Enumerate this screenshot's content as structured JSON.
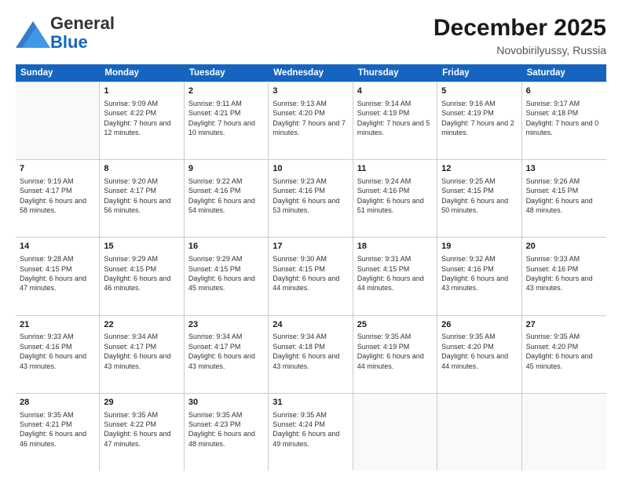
{
  "logo": {
    "line1": "General",
    "line2": "Blue"
  },
  "header": {
    "month": "December 2025",
    "location": "Novobirilyussy, Russia"
  },
  "days": [
    "Sunday",
    "Monday",
    "Tuesday",
    "Wednesday",
    "Thursday",
    "Friday",
    "Saturday"
  ],
  "weeks": [
    [
      {
        "num": "",
        "sunrise": "",
        "sunset": "",
        "daylight": ""
      },
      {
        "num": "1",
        "sunrise": "Sunrise: 9:09 AM",
        "sunset": "Sunset: 4:22 PM",
        "daylight": "Daylight: 7 hours and 12 minutes."
      },
      {
        "num": "2",
        "sunrise": "Sunrise: 9:11 AM",
        "sunset": "Sunset: 4:21 PM",
        "daylight": "Daylight: 7 hours and 10 minutes."
      },
      {
        "num": "3",
        "sunrise": "Sunrise: 9:13 AM",
        "sunset": "Sunset: 4:20 PM",
        "daylight": "Daylight: 7 hours and 7 minutes."
      },
      {
        "num": "4",
        "sunrise": "Sunrise: 9:14 AM",
        "sunset": "Sunset: 4:19 PM",
        "daylight": "Daylight: 7 hours and 5 minutes."
      },
      {
        "num": "5",
        "sunrise": "Sunrise: 9:16 AM",
        "sunset": "Sunset: 4:19 PM",
        "daylight": "Daylight: 7 hours and 2 minutes."
      },
      {
        "num": "6",
        "sunrise": "Sunrise: 9:17 AM",
        "sunset": "Sunset: 4:18 PM",
        "daylight": "Daylight: 7 hours and 0 minutes."
      }
    ],
    [
      {
        "num": "7",
        "sunrise": "Sunrise: 9:19 AM",
        "sunset": "Sunset: 4:17 PM",
        "daylight": "Daylight: 6 hours and 58 minutes."
      },
      {
        "num": "8",
        "sunrise": "Sunrise: 9:20 AM",
        "sunset": "Sunset: 4:17 PM",
        "daylight": "Daylight: 6 hours and 56 minutes."
      },
      {
        "num": "9",
        "sunrise": "Sunrise: 9:22 AM",
        "sunset": "Sunset: 4:16 PM",
        "daylight": "Daylight: 6 hours and 54 minutes."
      },
      {
        "num": "10",
        "sunrise": "Sunrise: 9:23 AM",
        "sunset": "Sunset: 4:16 PM",
        "daylight": "Daylight: 6 hours and 53 minutes."
      },
      {
        "num": "11",
        "sunrise": "Sunrise: 9:24 AM",
        "sunset": "Sunset: 4:16 PM",
        "daylight": "Daylight: 6 hours and 51 minutes."
      },
      {
        "num": "12",
        "sunrise": "Sunrise: 9:25 AM",
        "sunset": "Sunset: 4:15 PM",
        "daylight": "Daylight: 6 hours and 50 minutes."
      },
      {
        "num": "13",
        "sunrise": "Sunrise: 9:26 AM",
        "sunset": "Sunset: 4:15 PM",
        "daylight": "Daylight: 6 hours and 48 minutes."
      }
    ],
    [
      {
        "num": "14",
        "sunrise": "Sunrise: 9:28 AM",
        "sunset": "Sunset: 4:15 PM",
        "daylight": "Daylight: 6 hours and 47 minutes."
      },
      {
        "num": "15",
        "sunrise": "Sunrise: 9:29 AM",
        "sunset": "Sunset: 4:15 PM",
        "daylight": "Daylight: 6 hours and 46 minutes."
      },
      {
        "num": "16",
        "sunrise": "Sunrise: 9:29 AM",
        "sunset": "Sunset: 4:15 PM",
        "daylight": "Daylight: 6 hours and 45 minutes."
      },
      {
        "num": "17",
        "sunrise": "Sunrise: 9:30 AM",
        "sunset": "Sunset: 4:15 PM",
        "daylight": "Daylight: 6 hours and 44 minutes."
      },
      {
        "num": "18",
        "sunrise": "Sunrise: 9:31 AM",
        "sunset": "Sunset: 4:15 PM",
        "daylight": "Daylight: 6 hours and 44 minutes."
      },
      {
        "num": "19",
        "sunrise": "Sunrise: 9:32 AM",
        "sunset": "Sunset: 4:16 PM",
        "daylight": "Daylight: 6 hours and 43 minutes."
      },
      {
        "num": "20",
        "sunrise": "Sunrise: 9:33 AM",
        "sunset": "Sunset: 4:16 PM",
        "daylight": "Daylight: 6 hours and 43 minutes."
      }
    ],
    [
      {
        "num": "21",
        "sunrise": "Sunrise: 9:33 AM",
        "sunset": "Sunset: 4:16 PM",
        "daylight": "Daylight: 6 hours and 43 minutes."
      },
      {
        "num": "22",
        "sunrise": "Sunrise: 9:34 AM",
        "sunset": "Sunset: 4:17 PM",
        "daylight": "Daylight: 6 hours and 43 minutes."
      },
      {
        "num": "23",
        "sunrise": "Sunrise: 9:34 AM",
        "sunset": "Sunset: 4:17 PM",
        "daylight": "Daylight: 6 hours and 43 minutes."
      },
      {
        "num": "24",
        "sunrise": "Sunrise: 9:34 AM",
        "sunset": "Sunset: 4:18 PM",
        "daylight": "Daylight: 6 hours and 43 minutes."
      },
      {
        "num": "25",
        "sunrise": "Sunrise: 9:35 AM",
        "sunset": "Sunset: 4:19 PM",
        "daylight": "Daylight: 6 hours and 44 minutes."
      },
      {
        "num": "26",
        "sunrise": "Sunrise: 9:35 AM",
        "sunset": "Sunset: 4:20 PM",
        "daylight": "Daylight: 6 hours and 44 minutes."
      },
      {
        "num": "27",
        "sunrise": "Sunrise: 9:35 AM",
        "sunset": "Sunset: 4:20 PM",
        "daylight": "Daylight: 6 hours and 45 minutes."
      }
    ],
    [
      {
        "num": "28",
        "sunrise": "Sunrise: 9:35 AM",
        "sunset": "Sunset: 4:21 PM",
        "daylight": "Daylight: 6 hours and 46 minutes."
      },
      {
        "num": "29",
        "sunrise": "Sunrise: 9:35 AM",
        "sunset": "Sunset: 4:22 PM",
        "daylight": "Daylight: 6 hours and 47 minutes."
      },
      {
        "num": "30",
        "sunrise": "Sunrise: 9:35 AM",
        "sunset": "Sunset: 4:23 PM",
        "daylight": "Daylight: 6 hours and 48 minutes."
      },
      {
        "num": "31",
        "sunrise": "Sunrise: 9:35 AM",
        "sunset": "Sunset: 4:24 PM",
        "daylight": "Daylight: 6 hours and 49 minutes."
      },
      {
        "num": "",
        "sunrise": "",
        "sunset": "",
        "daylight": ""
      },
      {
        "num": "",
        "sunrise": "",
        "sunset": "",
        "daylight": ""
      },
      {
        "num": "",
        "sunrise": "",
        "sunset": "",
        "daylight": ""
      }
    ]
  ]
}
